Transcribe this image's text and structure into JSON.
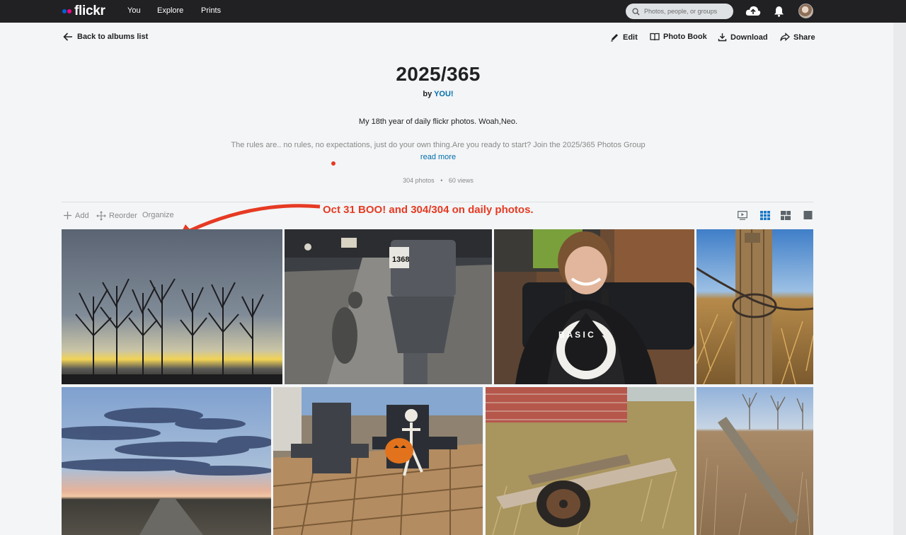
{
  "nav": {
    "logo": "flickr",
    "links": [
      "You",
      "Explore",
      "Prints"
    ],
    "search_placeholder": "Photos, people, or groups",
    "icons": [
      "search-icon",
      "upload-cloud-icon",
      "notification-bell-icon",
      "avatar"
    ]
  },
  "album": {
    "back_label": "Back to albums list",
    "actions": {
      "edit": "Edit",
      "photo_book": "Photo Book",
      "download": "Download",
      "share": "Share"
    },
    "title": "2025/365",
    "by_prefix": "by",
    "owner": "YOU!",
    "description_line1": "My 18th year of daily flickr photos. Woah,Neo.",
    "description_line2": "The rules are.. no rules, no expectations, just do your own thing.Are you ready to start? Join the 2025/365 Photos Group",
    "read_more": "read more",
    "photo_count": "304 photos",
    "separator": "•",
    "view_count": "60 views"
  },
  "toolbar": {
    "add": "Add",
    "reorder": "Reorder",
    "organize": "Organize",
    "view_icons": [
      "slideshow-icon",
      "grid-view-icon",
      "justified-view-icon",
      "single-view-icon"
    ]
  },
  "annotation": {
    "text": "Oct 31 BOO! and 304/304 on daily photos.",
    "color": "#e63a23"
  },
  "colors": {
    "topbar": "#212124",
    "link": "#006dac",
    "accent_red": "#e63a23",
    "page_bg": "#f3f5f6"
  },
  "photos": [
    "sunset-trees-photo",
    "parking-meter-photo",
    "woman-basic-witch-shirt-photo",
    "fence-post-barbed-wire-photo",
    "prairie-road-sunset-photo",
    "skeleton-pumpkin-chairs-photo",
    "broken-cart-wheel-photo",
    "leaning-post-field-photo"
  ]
}
